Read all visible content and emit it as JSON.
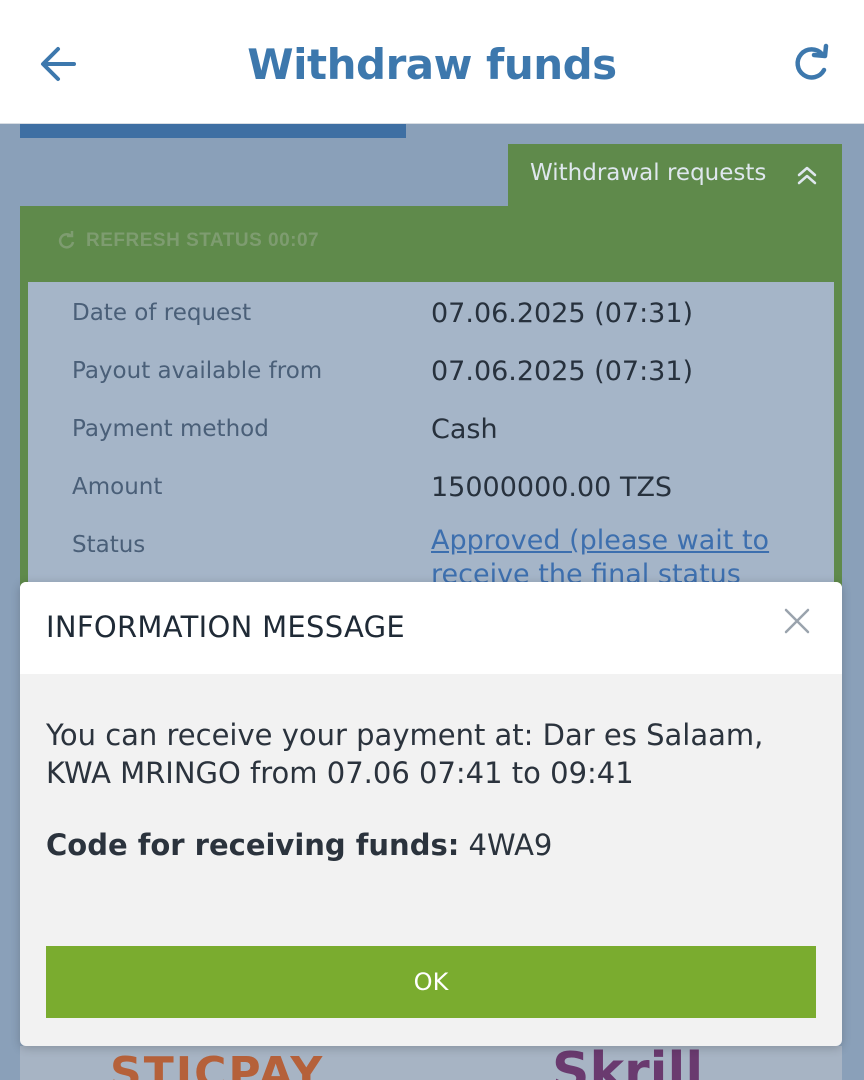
{
  "header": {
    "title": "Withdraw funds",
    "back_icon": "arrow-left-icon",
    "refresh_icon": "refresh-icon"
  },
  "withdrawal_tab": {
    "label": "Withdrawal requests",
    "icon": "chevron-double-up-icon"
  },
  "refresh_status": {
    "label": "REFRESH STATUS 00:07",
    "icon": "refresh-icon"
  },
  "details": [
    {
      "label": "Date of request",
      "value": "07.06.2025 (07:31)"
    },
    {
      "label": "Payout available from",
      "value": "07.06.2025 (07:31)"
    },
    {
      "label": "Payment method",
      "value": "Cash"
    },
    {
      "label": "Amount",
      "value": "15000000.00 TZS"
    },
    {
      "label": "Status",
      "value": "Approved (please wait to receive the final status"
    }
  ],
  "modal": {
    "title": "INFORMATION MESSAGE",
    "message": "You can receive your payment at: Dar es Salaam, KWA MRINGO from 07.06 07:41 to 09:41",
    "code_label": "Code for receiving funds:",
    "code_value": "4WA9",
    "ok_label": "OK",
    "close_icon": "close-icon"
  },
  "logos": {
    "left": "STICPAY",
    "right": "Skrill"
  },
  "colors": {
    "header_title": "#3d78ad",
    "green_panel": "#5f8a4b",
    "ok_button": "#7aac2f",
    "link": "#3d6fae"
  }
}
